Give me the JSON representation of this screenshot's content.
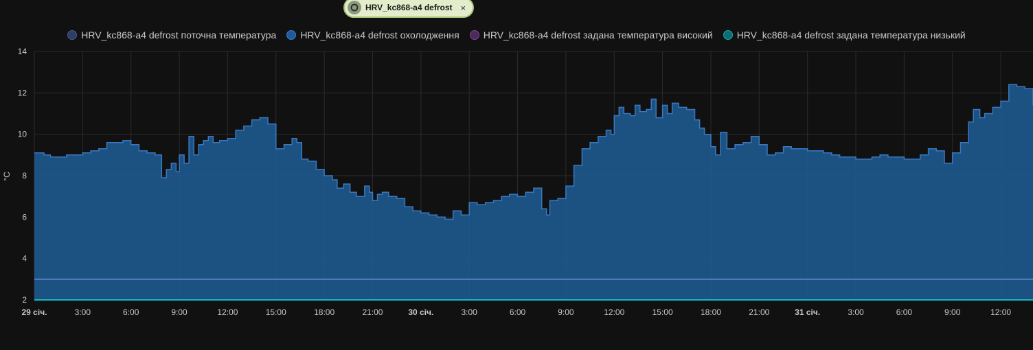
{
  "chip": {
    "label": "HRV_kc868-a4 defrost",
    "icon": "entity-refresh-icon",
    "close": "×"
  },
  "colors": {
    "background": "#111111",
    "grid": "#2b2b2b",
    "current": "#1e5a8f",
    "current_line": "#3a78c2",
    "cooling": "#6c88d4",
    "high": "#6a3a7a",
    "low": "#14b8c4"
  },
  "chart_data": {
    "type": "area",
    "ylabel": "°C",
    "ylim": [
      2,
      14
    ],
    "yticks": [
      "2",
      "4",
      "6",
      "8",
      "10",
      "12",
      "14"
    ],
    "x_unit": "hours since 29 січ. 00:00",
    "xlim": [
      0,
      62
    ],
    "xticks": [
      {
        "x": 0,
        "label": "29 січ.",
        "bold": true
      },
      {
        "x": 3,
        "label": "3:00"
      },
      {
        "x": 6,
        "label": "6:00"
      },
      {
        "x": 9,
        "label": "9:00"
      },
      {
        "x": 12,
        "label": "12:00"
      },
      {
        "x": 15,
        "label": "15:00"
      },
      {
        "x": 18,
        "label": "18:00"
      },
      {
        "x": 21,
        "label": "21:00"
      },
      {
        "x": 24,
        "label": "30 січ.",
        "bold": true
      },
      {
        "x": 27,
        "label": "3:00"
      },
      {
        "x": 30,
        "label": "6:00"
      },
      {
        "x": 33,
        "label": "9:00"
      },
      {
        "x": 36,
        "label": "12:00"
      },
      {
        "x": 39,
        "label": "15:00"
      },
      {
        "x": 42,
        "label": "18:00"
      },
      {
        "x": 45,
        "label": "21:00"
      },
      {
        "x": 48,
        "label": "31 січ.",
        "bold": true
      },
      {
        "x": 51,
        "label": "3:00"
      },
      {
        "x": 54,
        "label": "6:00"
      },
      {
        "x": 57,
        "label": "9:00"
      },
      {
        "x": 60,
        "label": "12:00"
      }
    ],
    "series": [
      {
        "name": "HRV_kc868-a4 defrost поточна температура",
        "type": "area",
        "x": [
          0,
          0.6,
          1,
          1.5,
          2,
          2.5,
          3,
          3.5,
          4,
          4.5,
          5,
          5.5,
          6,
          6.5,
          7,
          7.5,
          7.9,
          8.2,
          8.5,
          8.8,
          9.0,
          9.3,
          9.6,
          9.9,
          10.2,
          10.5,
          10.8,
          11.1,
          11.5,
          12,
          12.5,
          13,
          13.5,
          14,
          14.5,
          15,
          15.5,
          16,
          16.3,
          16.6,
          17,
          17.5,
          18,
          18.5,
          18.8,
          19.2,
          19.6,
          20,
          20.5,
          20.8,
          21,
          21.3,
          21.6,
          22,
          22.5,
          23,
          23.5,
          24,
          24.5,
          25,
          25.5,
          26,
          26.5,
          27,
          27.5,
          28,
          28.5,
          29,
          29.5,
          30,
          30.5,
          31,
          31.5,
          31.8,
          32,
          32.5,
          33,
          33.5,
          34,
          34.5,
          35,
          35.5,
          35.8,
          36,
          36.3,
          36.6,
          37,
          37.3,
          37.6,
          38,
          38.3,
          38.6,
          39,
          39.3,
          39.6,
          40,
          40.5,
          41,
          41.3,
          41.6,
          42,
          42.3,
          42.6,
          43,
          43.5,
          44,
          44.5,
          45,
          45.5,
          46,
          46.5,
          47,
          47.5,
          48,
          48.5,
          49,
          49.5,
          50,
          50.5,
          51,
          51.5,
          52,
          52.5,
          53,
          53.5,
          54,
          54.5,
          55,
          55.5,
          56,
          56.5,
          57,
          57.5,
          58,
          58.3,
          58.7,
          59,
          59.5,
          60,
          60.5,
          61,
          61.5,
          62
        ],
        "y": [
          9.1,
          9.0,
          8.9,
          8.9,
          9.0,
          9.0,
          9.1,
          9.2,
          9.3,
          9.6,
          9.6,
          9.7,
          9.5,
          9.2,
          9.1,
          9.0,
          7.9,
          8.3,
          8.6,
          8.2,
          9.0,
          8.6,
          9.9,
          9.0,
          9.5,
          9.7,
          9.9,
          9.6,
          9.7,
          9.8,
          10.2,
          10.4,
          10.7,
          10.8,
          10.5,
          9.3,
          9.5,
          9.8,
          9.6,
          8.8,
          8.7,
          8.3,
          8.0,
          7.8,
          7.4,
          7.6,
          7.2,
          7.0,
          7.5,
          7.2,
          6.8,
          7.1,
          7.2,
          7.0,
          6.9,
          6.5,
          6.3,
          6.2,
          6.1,
          6.0,
          5.9,
          6.3,
          6.1,
          6.7,
          6.6,
          6.7,
          6.8,
          7.0,
          7.1,
          7.0,
          7.2,
          7.4,
          6.4,
          6.1,
          6.8,
          6.9,
          7.5,
          8.5,
          9.3,
          9.6,
          9.9,
          10.2,
          10.0,
          10.9,
          11.3,
          11.0,
          10.9,
          11.4,
          11.1,
          11.2,
          11.7,
          10.8,
          11.4,
          11.0,
          11.5,
          11.3,
          11.2,
          10.7,
          10.3,
          10.0,
          9.4,
          9.0,
          10.1,
          9.3,
          9.5,
          9.6,
          9.9,
          9.5,
          9.0,
          9.1,
          9.4,
          9.3,
          9.3,
          9.2,
          9.2,
          9.1,
          9.0,
          8.9,
          8.9,
          8.8,
          8.8,
          8.9,
          9.0,
          8.9,
          8.9,
          8.8,
          8.8,
          9.0,
          9.3,
          9.2,
          8.6,
          9.1,
          9.6,
          10.6,
          11.2,
          10.8,
          11.0,
          11.3,
          11.6,
          12.4,
          12.3,
          12.2,
          11.4
        ]
      },
      {
        "name": "HRV_kc868-a4 defrost охолодження",
        "type": "line",
        "x": [
          0,
          62
        ],
        "y": [
          3,
          3
        ]
      },
      {
        "name": "HRV_kc868-a4 defrost задана температура високий",
        "type": "line",
        "x": [],
        "y": []
      },
      {
        "name": "HRV_kc868-a4 defrost задана температура низький",
        "type": "line",
        "x": [
          0,
          62
        ],
        "y": [
          2,
          2
        ]
      }
    ],
    "legend_placement": "top-center",
    "grid": true
  },
  "legend": [
    {
      "label": "HRV_kc868-a4 defrost поточна температура",
      "color": "#2c3e66",
      "border": "#4a5c88"
    },
    {
      "label": "HRV_kc868-a4 defrost охолодження",
      "color": "#1e5a9a",
      "border": "#3b7ec4"
    },
    {
      "label": "HRV_kc868-a4 defrost задана температура високий",
      "color": "#4e2a5c",
      "border": "#7a4a8e"
    },
    {
      "label": "HRV_kc868-a4 defrost задана температура низький",
      "color": "#0c6e72",
      "border": "#15a8ad"
    }
  ]
}
